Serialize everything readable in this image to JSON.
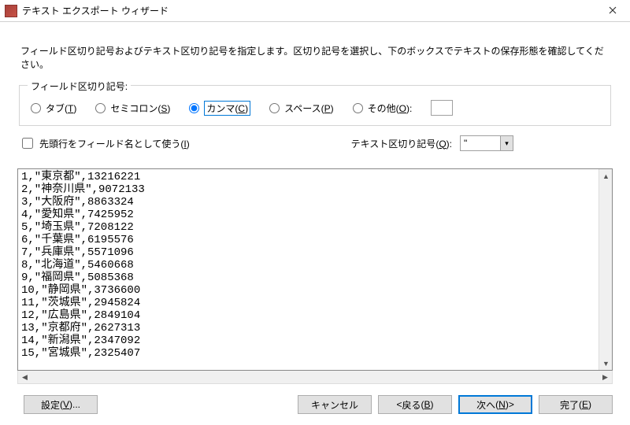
{
  "window": {
    "title": "テキスト エクスポート ウィザード"
  },
  "instruction": "フィールド区切り記号およびテキスト区切り記号を指定します。区切り記号を選択し、下のボックスでテキストの保存形態を確認してください。",
  "delimiter_group": {
    "legend": "フィールド区切り記号:",
    "selected": "comma",
    "options": {
      "tab": {
        "label": "タブ",
        "accel": "T"
      },
      "semicolon": {
        "label": "セミコロン",
        "accel": "S"
      },
      "comma": {
        "label": "カンマ",
        "accel": "C"
      },
      "space": {
        "label": "スペース",
        "accel": "P"
      },
      "other": {
        "label": "その他",
        "accel": "O"
      }
    },
    "other_value": ""
  },
  "first_row_fieldnames": {
    "label": "先頭行をフィールド名として使う",
    "accel": "I",
    "checked": false
  },
  "text_qualifier": {
    "label": "テキスト区切り記号",
    "accel": "Q",
    "value": "\""
  },
  "preview_rows": [
    "1,\"東京都\",13216221",
    "2,\"神奈川県\",9072133",
    "3,\"大阪府\",8863324",
    "4,\"愛知県\",7425952",
    "5,\"埼玉県\",7208122",
    "6,\"千葉県\",6195576",
    "7,\"兵庫県\",5571096",
    "8,\"北海道\",5460668",
    "9,\"福岡県\",5085368",
    "10,\"静岡県\",3736600",
    "11,\"茨城県\",2945824",
    "12,\"広島県\",2849104",
    "13,\"京都府\",2627313",
    "14,\"新潟県\",2347092",
    "15,\"宮城県\",2325407"
  ],
  "buttons": {
    "settings": {
      "label": "設定",
      "accel": "V",
      "suffix": "..."
    },
    "cancel": {
      "label": "キャンセル"
    },
    "back": {
      "label": "戻る",
      "accel": "B",
      "prefix": "< "
    },
    "next": {
      "label": "次へ",
      "accel": "N",
      "suffix": " >"
    },
    "finish": {
      "label": "完了",
      "accel": "E"
    }
  }
}
